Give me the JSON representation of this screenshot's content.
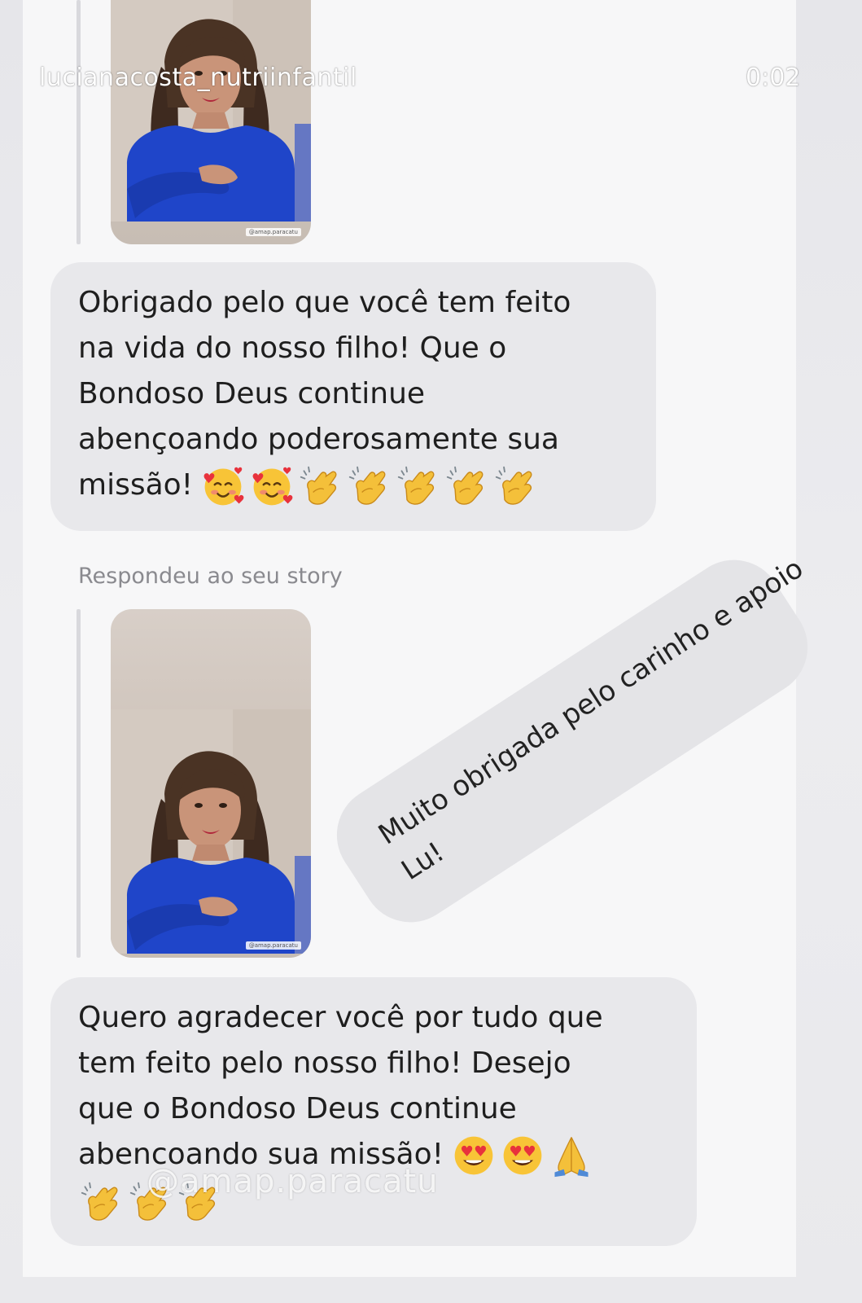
{
  "story": {
    "username": "lucianacosta_nutriinfantil",
    "time": "0:02",
    "watermark": "@amap.paracatu"
  },
  "conversation": {
    "thumb_tag": "@amap.paracatu",
    "message_1": {
      "lines": [
        "Obrigado pelo que você tem feito",
        "na vida do nosso filho! Que o",
        "Bondoso Deus continue",
        "abençoando poderosamente sua",
        "missão!"
      ],
      "emojis": [
        "smiling-face-with-hearts",
        "smiling-face-with-hearts",
        "clapping-hands",
        "clapping-hands",
        "clapping-hands",
        "clapping-hands",
        "clapping-hands"
      ]
    },
    "reply_label": "Respondeu ao seu story",
    "reply_message": {
      "lines": [
        "Muito obrigada pelo carinho e apoio",
        "Lu!"
      ]
    },
    "message_2": {
      "lines": [
        "Quero agradecer você por tudo que",
        "tem feito pelo nosso filho! Desejo",
        "que o Bondoso Deus continue",
        "abencoando sua missão!"
      ],
      "emojis_line4": [
        "heart-eyes",
        "heart-eyes",
        "folded-hands"
      ],
      "emojis_line5": [
        "clapping-hands",
        "clapping-hands",
        "clapping-hands"
      ]
    }
  },
  "colors": {
    "bubble": "#e8e8eb",
    "text": "#1e1e1e",
    "muted": "#8a8a8f",
    "shirt_blue": "#1f45c9"
  }
}
